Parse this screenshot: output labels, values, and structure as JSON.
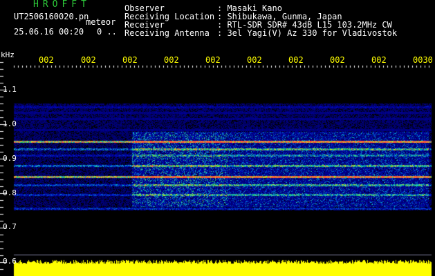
{
  "header": {
    "brand": "HROFFT",
    "filename": "UT2506160020.pn",
    "mode": "meteor",
    "datetime": "25.06.16 00:20",
    "count": "0 ..",
    "fields": [
      {
        "label": "Observer",
        "value": ": Masaki Kano"
      },
      {
        "label": "Receiving Location",
        "value": ": Shibukawa, Gunma, Japan"
      },
      {
        "label": "Receiver",
        "value": ": RTL-SDR SDR# 43dB L15 103.2MHz CW"
      },
      {
        "label": "Receiving Antenna",
        "value": ": 3el Yagi(V) Az 330 for Vladivostok"
      }
    ]
  },
  "time_axis": {
    "labels": [
      "002",
      "002",
      "002",
      "002",
      "002",
      "002",
      "002",
      "002",
      "002",
      "0030"
    ]
  },
  "freq_axis": {
    "unit": "kHz",
    "labels": [
      "1.1",
      "1.0",
      "0.9",
      "0.8",
      "0.7",
      "0.6"
    ]
  },
  "colors": {
    "text": "#ffffff",
    "accent": "#ffff00",
    "brand": "#2ecc3a",
    "background": "#000000",
    "noise": "#0a1496",
    "signal_line": "#ff3050",
    "level_bar": "#ffff00"
  }
}
